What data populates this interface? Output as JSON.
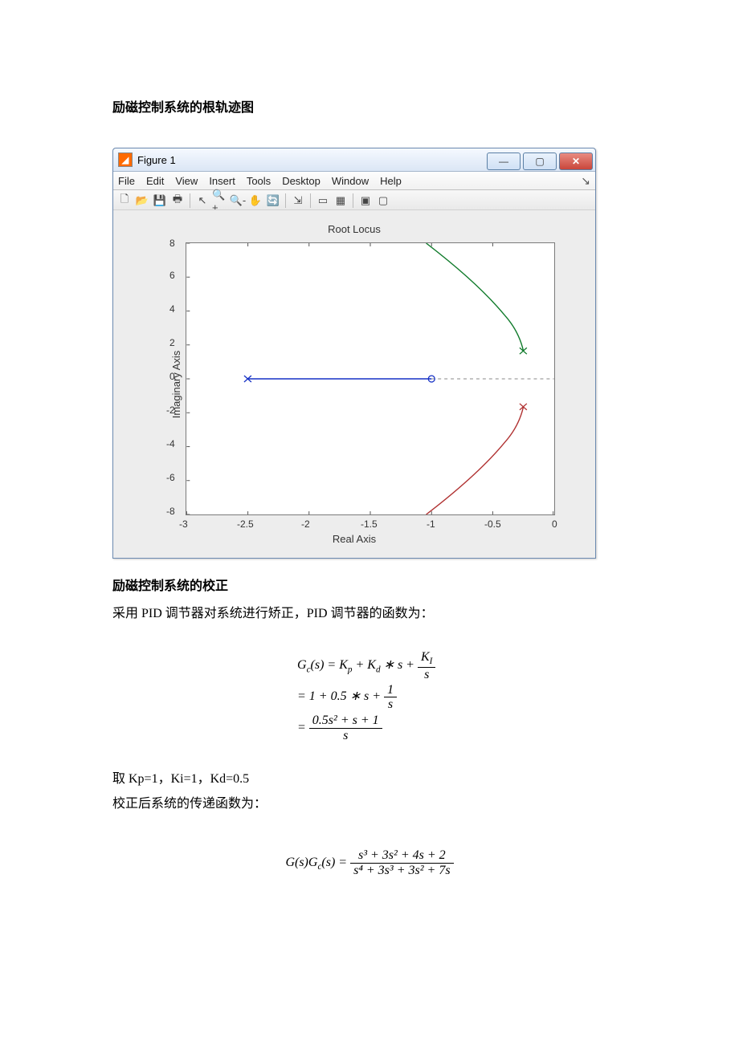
{
  "doc": {
    "heading1": "励磁控制系统的根轨迹图",
    "heading2": "励磁控制系统的校正",
    "para1": "采用 PID 调节器对系统进行矫正，PID 调节器的函数为：",
    "para2": "取 Kp=1，Ki=1，Kd=0.5",
    "para3": "校正后系统的传递函数为："
  },
  "window": {
    "title": "Figure 1",
    "icon_glyph": "◢",
    "btn_min": "—",
    "btn_max": "▢",
    "btn_close": "✕",
    "menus": [
      "File",
      "Edit",
      "View",
      "Insert",
      "Tools",
      "Desktop",
      "Window",
      "Help"
    ],
    "menubar_right": "↘",
    "tool_icons": [
      "🗋",
      "📂",
      "💾",
      "🖶",
      "|",
      "↖",
      "🔍+",
      "🔍-",
      "✋",
      "🔄",
      "|",
      "⇲",
      "|",
      "▭",
      "▦",
      "|",
      "▣",
      "▢"
    ]
  },
  "chart_data": {
    "type": "root_locus",
    "title": "Root Locus",
    "xlabel": "Real Axis",
    "ylabel": "Imaginary Axis",
    "xlim": [
      -3,
      0
    ],
    "ylim": [
      -8,
      8
    ],
    "xticks": [
      -3,
      -2.5,
      -2,
      -1.5,
      -1,
      -0.5,
      0
    ],
    "yticks": [
      -8,
      -6,
      -4,
      -2,
      0,
      2,
      4,
      6,
      8
    ],
    "open_loop_zero": {
      "real": -1.0,
      "imag": 0
    },
    "open_loop_poles": [
      {
        "real": -2.5,
        "imag": 0
      },
      {
        "real": -0.25,
        "imag": 1.65
      },
      {
        "real": -0.25,
        "imag": -1.65
      }
    ],
    "branches": [
      {
        "name": "real_axis_branch",
        "color": "#1530c5",
        "points": [
          {
            "x": -2.5,
            "y": 0
          },
          {
            "x": -1.0,
            "y": 0
          }
        ]
      },
      {
        "name": "zero_to_infinity_dotted",
        "color": "#888888",
        "style": "dashed",
        "points": [
          {
            "x": -1.0,
            "y": 0
          },
          {
            "x": 0.0,
            "y": 0
          }
        ]
      },
      {
        "name": "upper_branch",
        "color": "#0f7a2a",
        "points": [
          {
            "x": -0.25,
            "y": 1.65
          },
          {
            "x": -0.3,
            "y": 2.2
          },
          {
            "x": -0.45,
            "y": 3.5
          },
          {
            "x": -0.7,
            "y": 5.5
          },
          {
            "x": -1.1,
            "y": 8.0
          }
        ]
      },
      {
        "name": "lower_branch",
        "color": "#b03131",
        "points": [
          {
            "x": -0.25,
            "y": -1.65
          },
          {
            "x": -0.3,
            "y": -2.2
          },
          {
            "x": -0.45,
            "y": -3.5
          },
          {
            "x": -0.7,
            "y": -5.5
          },
          {
            "x": -1.1,
            "y": -8.0
          }
        ]
      }
    ]
  },
  "equations": {
    "eq1_line1_lhs": "G",
    "eq1_line1_sub": "c",
    "eq1_line1_arg": "(s) = K",
    "eq1_line1_kp_sub": "p",
    "eq1_line1_mid": " + K",
    "eq1_line1_kd_sub": "d",
    "eq1_line1_star": " ∗ s + ",
    "eq1_frac1_num": "K",
    "eq1_frac1_num_sub": "I",
    "eq1_frac1_den": "s",
    "eq1_line2_pre": "= 1 + 0.5 ∗ s + ",
    "eq1_frac2_num": "1",
    "eq1_frac2_den": "s",
    "eq1_line3_pre": "= ",
    "eq1_frac3_num": "0.5s² + s + 1",
    "eq1_frac3_den": "s",
    "eq2_lhs1": "G(s)G",
    "eq2_sub": "c",
    "eq2_lhs2": "(s) = ",
    "eq2_num": "s³ + 3s² + 4s + 2",
    "eq2_den": "s⁴ + 3s³ + 3s² + 7s"
  }
}
